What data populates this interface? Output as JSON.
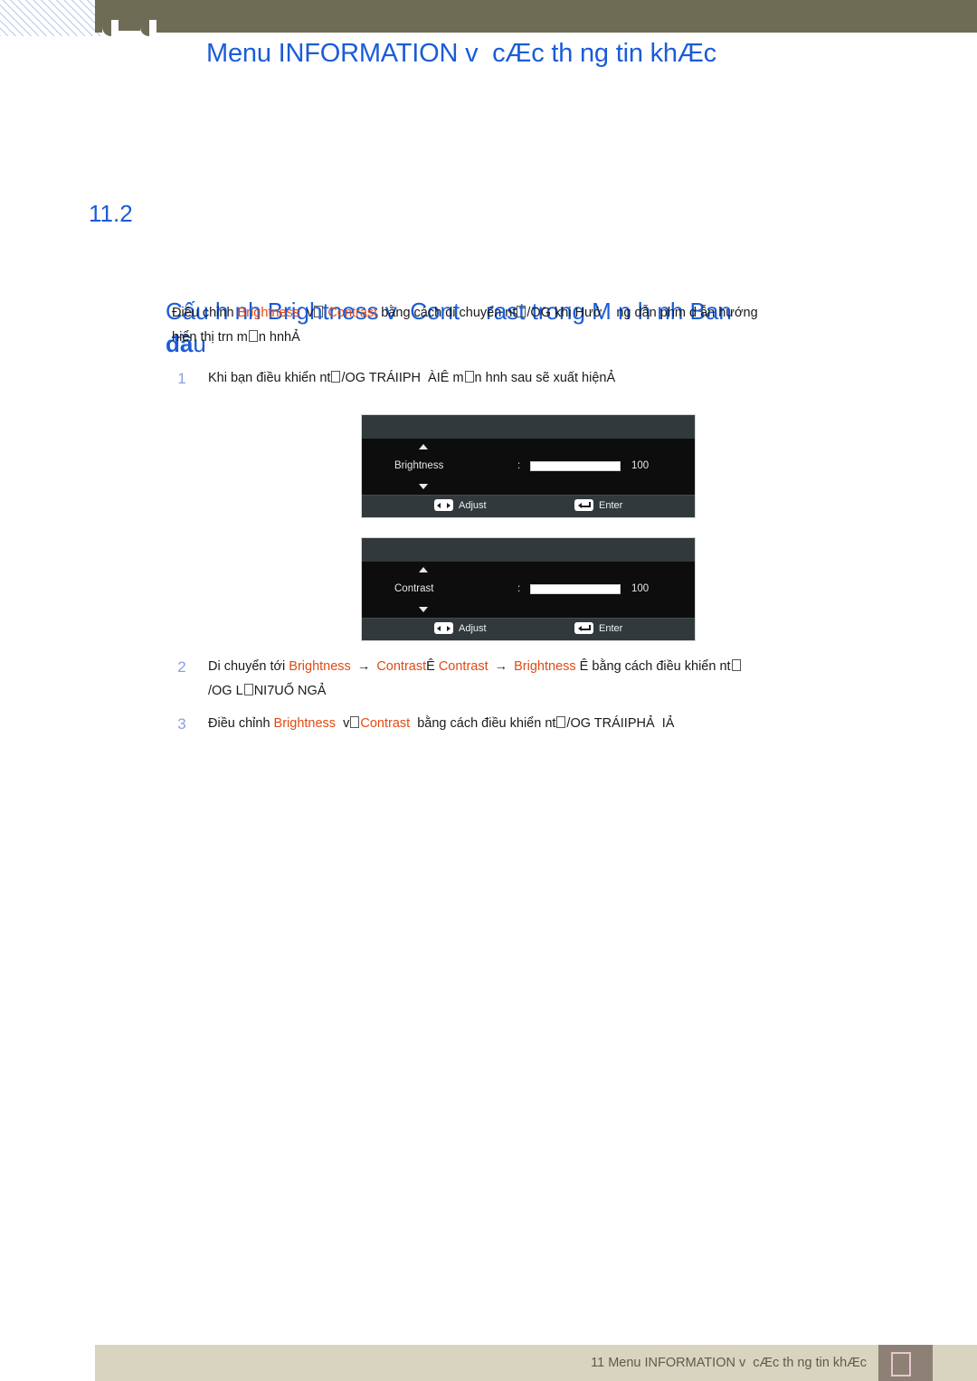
{
  "document": {
    "chapter_number": "11",
    "header_title": "Menu INFORMATION v  cÆc th ng tin khÆc",
    "accent_blue": "#1b5cd8",
    "accent_orange": "#e24a14",
    "olive": "#6e6c55",
    "footer_beige": "#d8d4bf"
  },
  "section": {
    "number": "11.2",
    "title_line1": "Cấu h nh Brightness v  Cont    rast trong M n h nh Ban",
    "title_line2_bold": "đầ",
    "title_line2_rest": "u"
  },
  "intro": {
    "t1": "Điều chỉnh ",
    "hl1": "Brightness",
    "t2": "  v",
    "t3": " ",
    "hl2": "Contrast",
    "t4": " bằng cách di chuyển nt",
    "t5": "/OG khi Hướ    ng dẫn phm d ẫn hướng",
    "t6": "hiển thị trn m",
    "t7": "n hnhẢ"
  },
  "steps": [
    {
      "number": "1",
      "t1": "Khi bạn điều khiển nt",
      "t2": "/OG TRÁIIPH  ÀIÊ m",
      "t3": "n hnh sau sẽ xuất hiệnẢ"
    },
    {
      "number": "2",
      "t1": "Di chuyển tới ",
      "hl1": "Brightness",
      "arrow1": "→",
      "hl2": "Contrast",
      "t2": "Ê ",
      "hl3": "Contrast",
      "arrow2": "→",
      "hl4": "Brightness",
      "t3": " Ê bằng cách điều khiển nt",
      "t4": "/OG L",
      "t5": "NI7UỐ NGẢ"
    },
    {
      "number": "3",
      "t1": "Điều chỉnh ",
      "hl1": "Brightness",
      "t2": "  v",
      "hl2": "Contrast",
      "t3": "  bằng cách điều khiển nt",
      "t4": "/OG TRÁIIPHẢ  IẢ"
    }
  ],
  "osd_panels": [
    {
      "label": "Brightness",
      "colon": ":",
      "value": "100",
      "slider_percent": 100,
      "adjust_label": "Adjust",
      "enter_label": "Enter"
    },
    {
      "label": "Contrast",
      "colon": ":",
      "value": "100",
      "slider_percent": 100,
      "adjust_label": "Adjust",
      "enter_label": "Enter"
    }
  ],
  "footer": {
    "text": "11 Menu INFORMATION v  cÆc th ng tin khÆc",
    "page_number": ""
  }
}
